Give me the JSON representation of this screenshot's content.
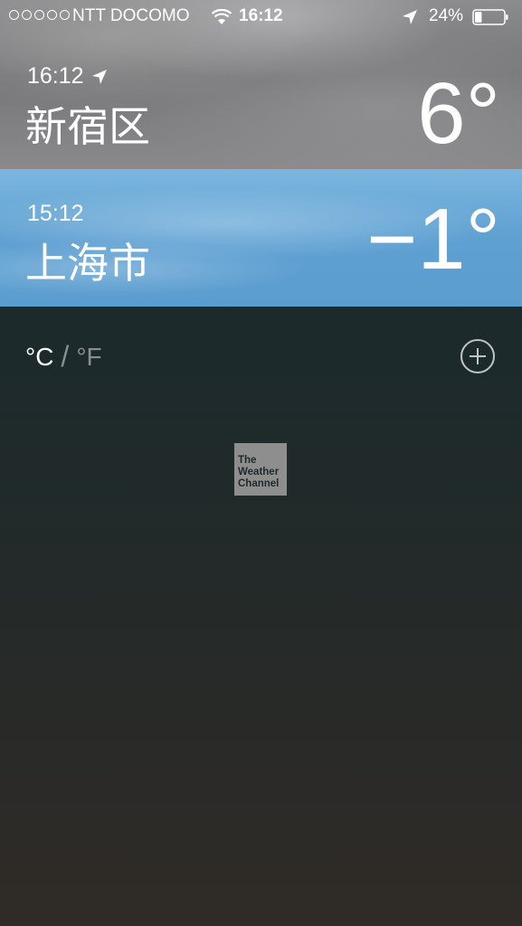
{
  "status_bar": {
    "carrier": "NTT DOCOMO",
    "time": "16:12",
    "battery_percent": "24%",
    "battery_level": 0.24,
    "signal_dots": 5
  },
  "cities": [
    {
      "time": "16:12",
      "name": "新宿区",
      "temperature": "6°",
      "current_location": true,
      "sky": "cloudy"
    },
    {
      "time": "15:12",
      "name": "上海市",
      "temperature": "−1°",
      "current_location": false,
      "sky": "clear"
    }
  ],
  "units": {
    "celsius": "°C",
    "separator": "/",
    "fahrenheit": "°F",
    "selected": "celsius"
  },
  "logo": {
    "line1": "The",
    "line2": "Weather",
    "line3": "Channel"
  },
  "colors": {
    "accent": "#ffffff",
    "muted": "#8a9092"
  }
}
